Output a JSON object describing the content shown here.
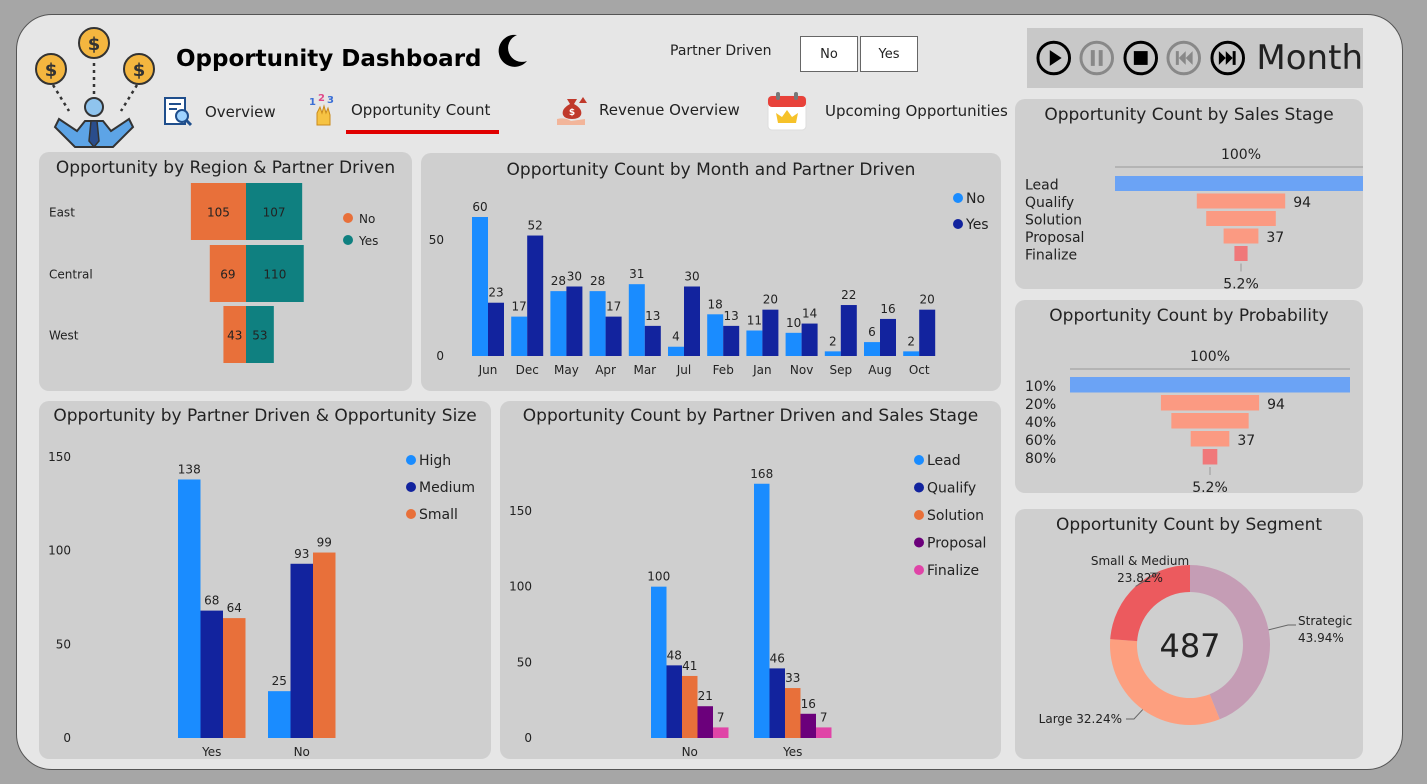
{
  "header": {
    "title": "Opportunity Dashboard",
    "partner_toggle_label": "Partner Driven",
    "toggle_no": "No",
    "toggle_yes": "Yes",
    "player_label": "Month"
  },
  "nav": {
    "items": [
      {
        "label": "Overview",
        "active": false
      },
      {
        "label": "Opportunity Count",
        "active": true
      },
      {
        "label": "Revenue Overview",
        "active": false
      },
      {
        "label": "Upcoming Opportunities",
        "active": false
      }
    ]
  },
  "colors": {
    "no_orange": "#e8703a",
    "yes_teal": "#0f8080",
    "light_blue": "#1a8cff",
    "dark_blue": "#12239e",
    "orange": "#e8703a",
    "purple": "#6b007b",
    "pink": "#e044a7",
    "funnel_top": "#6ba3f5",
    "funnel_mid": "#fb9a82",
    "funnel_low": "#f0787a",
    "donut_strategic": "#c59db5",
    "donut_large": "#fd9f7f",
    "donut_small": "#ec5a5e"
  },
  "chart_data": [
    {
      "id": "region",
      "type": "bar",
      "orientation": "diverging-horizontal",
      "title": "Opportunity by Region & Partner Driven",
      "categories": [
        "East",
        "Central",
        "West"
      ],
      "series": [
        {
          "name": "No",
          "values": [
            105,
            69,
            43
          ]
        },
        {
          "name": "Yes",
          "values": [
            107,
            110,
            53
          ]
        }
      ],
      "legend": "right"
    },
    {
      "id": "month",
      "type": "bar",
      "title": "Opportunity Count by Month and Partner Driven",
      "categories": [
        "Jun",
        "Dec",
        "May",
        "Apr",
        "Mar",
        "Jul",
        "Feb",
        "Jan",
        "Nov",
        "Sep",
        "Aug",
        "Oct"
      ],
      "series": [
        {
          "name": "No",
          "values": [
            60,
            17,
            28,
            28,
            31,
            4,
            18,
            11,
            10,
            2,
            6,
            2
          ]
        },
        {
          "name": "Yes",
          "values": [
            23,
            52,
            30,
            17,
            13,
            30,
            13,
            20,
            14,
            22,
            16,
            20
          ]
        }
      ],
      "ylim": [
        0,
        60
      ],
      "yticks": [
        0,
        50
      ],
      "legend": "top-right"
    },
    {
      "id": "size",
      "type": "bar",
      "title": "Opportunity by Partner Driven & Opportunity Size",
      "categories": [
        "Yes",
        "No"
      ],
      "series": [
        {
          "name": "High",
          "values": [
            138,
            25
          ]
        },
        {
          "name": "Medium",
          "values": [
            68,
            93
          ]
        },
        {
          "name": "Small",
          "values": [
            64,
            99
          ]
        }
      ],
      "ylim": [
        0,
        150
      ],
      "yticks": [
        0,
        50,
        100,
        150
      ],
      "legend": "top-right"
    },
    {
      "id": "stage",
      "type": "bar",
      "title": "Opportunity Count by Partner Driven and Sales Stage",
      "categories": [
        "No",
        "Yes"
      ],
      "series": [
        {
          "name": "Lead",
          "values": [
            100,
            168
          ]
        },
        {
          "name": "Qualify",
          "values": [
            48,
            46
          ]
        },
        {
          "name": "Solution",
          "values": [
            41,
            33
          ]
        },
        {
          "name": "Proposal",
          "values": [
            21,
            16
          ]
        },
        {
          "name": "Finalize",
          "values": [
            7,
            7
          ]
        }
      ],
      "ylim": [
        0,
        180
      ],
      "yticks": [
        0,
        50,
        100,
        150
      ],
      "legend": "top-right"
    },
    {
      "id": "funnel_stage",
      "type": "bar",
      "subtype": "funnel",
      "title": "Opportunity Count by Sales Stage",
      "categories": [
        "Lead",
        "Qualify",
        "Solution",
        "Proposal",
        "Finalize"
      ],
      "values": [
        268,
        94,
        74,
        37,
        14
      ],
      "value_labels": [
        "",
        "94",
        "",
        "37",
        ""
      ],
      "top_label": "100%",
      "bottom_label": "5.2%"
    },
    {
      "id": "funnel_prob",
      "type": "bar",
      "subtype": "funnel",
      "title": "Opportunity Count by Probability",
      "categories": [
        "10%",
        "20%",
        "40%",
        "60%",
        "80%"
      ],
      "values": [
        268,
        94,
        74,
        37,
        14
      ],
      "value_labels": [
        "",
        "94",
        "",
        "37",
        ""
      ],
      "top_label": "100%",
      "bottom_label": "5.2%"
    },
    {
      "id": "segment",
      "type": "pie",
      "subtype": "donut",
      "title": "Opportunity Count by Segment",
      "categories": [
        "Strategic",
        "Large",
        "Small & Medium"
      ],
      "values": [
        43.94,
        32.24,
        23.82
      ],
      "label_text": [
        "43.94%",
        "32.24%",
        "23.82%"
      ],
      "center_value": "487"
    }
  ]
}
